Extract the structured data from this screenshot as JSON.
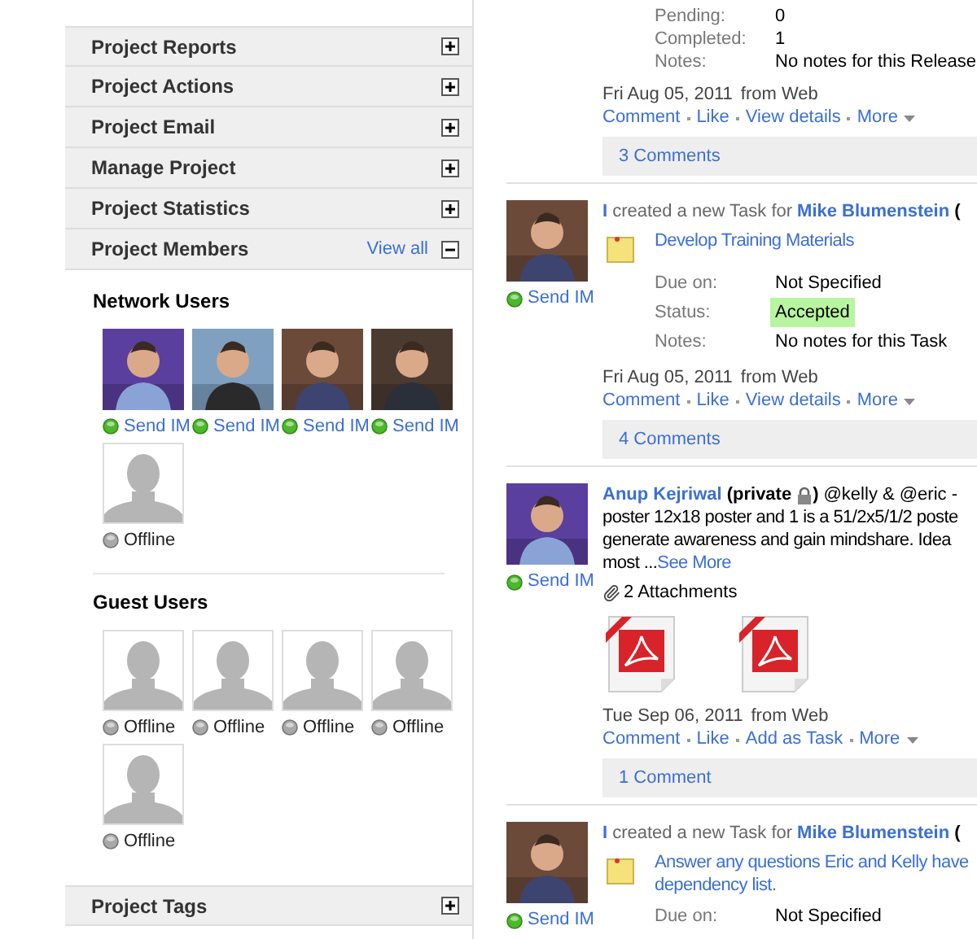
{
  "sidebar": {
    "sections": [
      {
        "title": "Project Reports",
        "expanded": false
      },
      {
        "title": "Project Actions",
        "expanded": false
      },
      {
        "title": "Project Email",
        "expanded": false
      },
      {
        "title": "Manage Project",
        "expanded": false
      },
      {
        "title": "Project Statistics",
        "expanded": false
      },
      {
        "title": "Project Members",
        "expanded": true,
        "link": "View all",
        "groups": [
          {
            "title": "Network Users",
            "users": [
              {
                "photo": true,
                "online": true,
                "status": "Send IM"
              },
              {
                "photo": true,
                "online": true,
                "status": "Send IM"
              },
              {
                "photo": true,
                "online": true,
                "status": "Send IM"
              },
              {
                "photo": true,
                "online": true,
                "status": "Send IM"
              },
              {
                "photo": false,
                "online": false,
                "status": "Offline"
              }
            ]
          },
          {
            "title": "Guest Users",
            "users": [
              {
                "photo": false,
                "online": false,
                "status": "Offline"
              },
              {
                "photo": false,
                "online": false,
                "status": "Offline"
              },
              {
                "photo": false,
                "online": false,
                "status": "Offline"
              },
              {
                "photo": false,
                "online": false,
                "status": "Offline"
              },
              {
                "photo": false,
                "online": false,
                "status": "Offline"
              }
            ]
          }
        ]
      },
      {
        "title": "Project Tags",
        "expanded": false
      }
    ]
  },
  "feed": [
    {
      "kind": "release",
      "fields": [
        {
          "label": "Pending:",
          "value": "0",
          "highlight": false
        },
        {
          "label": "Completed:",
          "value": "1",
          "highlight": false
        },
        {
          "label": "Notes:",
          "value": "No notes for this Release",
          "highlight": false
        }
      ],
      "date": "Fri Aug 05, 2011",
      "source": "from Web",
      "actions": [
        {
          "label": "Comment",
          "menu": false
        },
        {
          "label": "Like",
          "menu": false
        },
        {
          "label": "View details",
          "menu": false
        },
        {
          "label": "More",
          "menu": true
        }
      ],
      "comments": "3 Comments"
    },
    {
      "kind": "task",
      "online": true,
      "im": "Send IM",
      "actor": "I",
      "verb": "created a new Task for",
      "target": "Mike Blumenstein",
      "trail": "(",
      "task": [
        "Develop Training Materials"
      ],
      "fields": [
        {
          "label": "Due on:",
          "value": "Not Specified",
          "highlight": false
        },
        {
          "label": "Status:",
          "value": "Accepted",
          "highlight": true
        },
        {
          "label": "Notes:",
          "value": "No notes for this Task",
          "highlight": false
        }
      ],
      "date": "Fri Aug 05, 2011",
      "source": "from Web",
      "actions": [
        {
          "label": "Comment",
          "menu": false
        },
        {
          "label": "Like",
          "menu": false
        },
        {
          "label": "View details",
          "menu": false
        },
        {
          "label": "More",
          "menu": true
        }
      ],
      "comments": "4 Comments"
    },
    {
      "kind": "post",
      "online": true,
      "im": "Send IM",
      "author": "Anup Kejriwal",
      "privacy": "(private",
      "privacy_end": ")",
      "lines": [
        "@kelly & @eric -",
        "poster 12x18 poster and 1 is a 51/2x5/1/2 poste",
        "generate awareness and gain mindshare. Idea",
        "most ..."
      ],
      "more": "See More",
      "attachments": "2 Attachments",
      "files": [
        {
          "kind": "pdf"
        },
        {
          "kind": "pdf"
        }
      ],
      "date": "Tue Sep 06, 2011",
      "source": "from Web",
      "actions": [
        {
          "label": "Comment",
          "menu": false
        },
        {
          "label": "Like",
          "menu": false
        },
        {
          "label": "Add as Task",
          "menu": false
        },
        {
          "label": "More",
          "menu": true
        }
      ],
      "comments": "1 Comment"
    },
    {
      "kind": "task",
      "online": true,
      "im": "Send IM",
      "actor": "I",
      "verb": "created a new Task for",
      "target": "Mike Blumenstein",
      "trail": "(",
      "task": [
        "Answer any questions Eric and Kelly have",
        "dependency list."
      ],
      "fields": [
        {
          "label": "Due on:",
          "value": "Not Specified",
          "highlight": false
        }
      ]
    }
  ]
}
